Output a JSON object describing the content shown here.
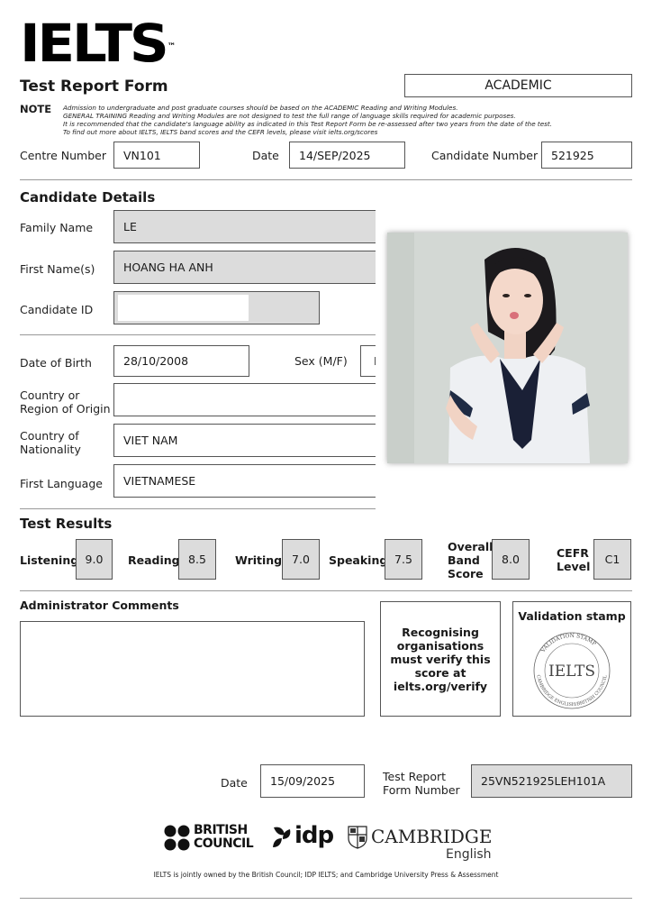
{
  "header": {
    "logo": "IELTS",
    "trademark": "™",
    "form_title": "Test Report Form",
    "module": "ACADEMIC"
  },
  "note": {
    "label": "NOTE",
    "lines": [
      "Admission to undergraduate and post graduate courses should be based on the ACADEMIC Reading and Writing Modules.",
      "GENERAL TRAINING Reading and Writing Modules are not designed to test the full range of language skills required for academic purposes.",
      "It is recommended that the candidate's language ability as indicated in this Test Report Form be re-assessed after two years from the date of the test.",
      "To find out more about IELTS, IELTS band scores and the CEFR levels, please visit ielts.org/scores"
    ]
  },
  "centre": {
    "centre_label": "Centre Number",
    "centre_value": "VN101",
    "date_label": "Date",
    "date_value": "14/SEP/2025",
    "candidate_label": "Candidate Number",
    "candidate_value": "521925"
  },
  "candidate": {
    "section_title": "Candidate Details",
    "family_name_label": "Family Name",
    "family_name": "LE",
    "first_name_label": "First Name(s)",
    "first_name": "HOANG HA ANH",
    "candidate_id_label": "Candidate ID",
    "candidate_id": "",
    "dob_label": "Date of Birth",
    "dob": "28/10/2008",
    "sex_label": "Sex (M/F)",
    "sex": "F",
    "country_origin_label_1": "Country or",
    "country_origin_label_2": "Region of Origin",
    "country_origin": "",
    "nationality_label_1": "Country of",
    "nationality_label_2": "Nationality",
    "nationality": "VIET NAM",
    "first_language_label": "First Language",
    "first_language": "VIETNAMESE"
  },
  "results": {
    "section_title": "Test Results",
    "listening_label": "Listening",
    "listening": "9.0",
    "reading_label": "Reading",
    "reading": "8.5",
    "writing_label": "Writing",
    "writing": "7.0",
    "speaking_label": "Speaking",
    "speaking": "7.5",
    "overall_label_1": "Overall",
    "overall_label_2": "Band",
    "overall_label_3": "Score",
    "overall": "8.0",
    "cefr_label_1": "CEFR",
    "cefr_label_2": "Level",
    "cefr": "C1"
  },
  "admin": {
    "comments_title": "Administrator Comments",
    "verify_text": "Recognising organisations must verify this score at ielts.org/verify",
    "stamp_title": "Validation stamp",
    "stamp_ring_text": "VALIDATION STAMP",
    "stamp_center": "IELTS",
    "stamp_bottom_text": "CAMBRIDGE ENGLISH/BRITISH COUNCIL"
  },
  "bottom": {
    "date_label": "Date",
    "date_value": "15/09/2025",
    "trf_label_1": "Test Report",
    "trf_label_2": "Form Number",
    "trf_value": "25VN521925LEH101A"
  },
  "partners": {
    "bc_1": "BRITISH",
    "bc_2": "COUNCIL",
    "idp": "idp",
    "cambridge_1": "CAMBRIDGE",
    "cambridge_2": "English"
  },
  "footer": "IELTS is jointly owned by the British Council; IDP IELTS; and Cambridge University Press & Assessment"
}
